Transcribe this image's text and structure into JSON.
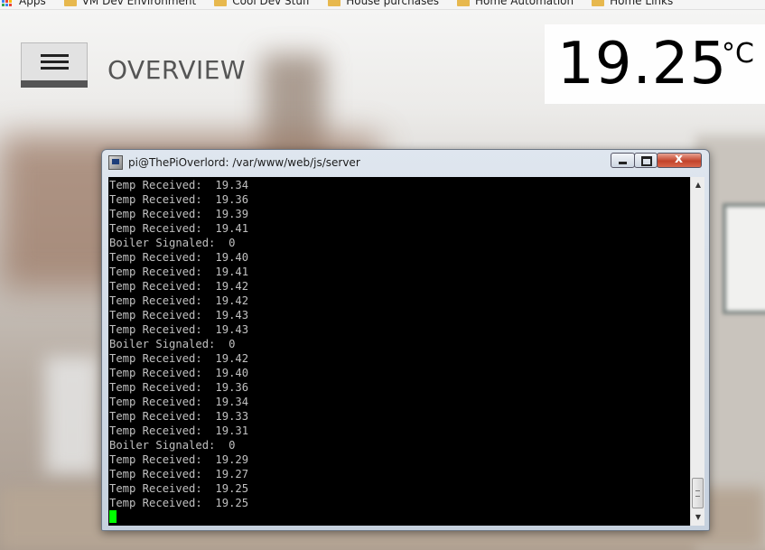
{
  "bookmarks": [
    {
      "label": "Apps",
      "icon": "apps-grid-icon"
    },
    {
      "label": "VM Dev Environment",
      "icon": "folder-icon"
    },
    {
      "label": "Cool Dev Stuff",
      "icon": "folder-icon"
    },
    {
      "label": "House purchases",
      "icon": "folder-icon"
    },
    {
      "label": "Home Automation",
      "icon": "folder-icon"
    },
    {
      "label": "Home Links",
      "icon": "folder-icon"
    }
  ],
  "header": {
    "menu_icon": "hamburger-menu-icon",
    "title": "OVERVIEW",
    "temperature": "19.25",
    "unit": "°C"
  },
  "terminal": {
    "title": "pi@ThePiOverlord: /var/www/web/js/server",
    "lines": [
      "Temp Received:  19.34",
      "Temp Received:  19.36",
      "Temp Received:  19.39",
      "Temp Received:  19.41",
      "Boiler Signaled:  0",
      "Temp Received:  19.40",
      "Temp Received:  19.41",
      "Temp Received:  19.42",
      "Temp Received:  19.42",
      "Temp Received:  19.43",
      "Temp Received:  19.43",
      "Boiler Signaled:  0",
      "Temp Received:  19.42",
      "Temp Received:  19.40",
      "Temp Received:  19.36",
      "Temp Received:  19.34",
      "Temp Received:  19.33",
      "Temp Received:  19.31",
      "Boiler Signaled:  0",
      "Temp Received:  19.29",
      "Temp Received:  19.27",
      "Temp Received:  19.25",
      "Temp Received:  19.25"
    ]
  },
  "colors": {
    "cursor": "#00ff00",
    "terminal_bg": "#000000",
    "terminal_text": "#c0c0c0",
    "folder": "#e7b84e",
    "close_button": "#c2432b"
  }
}
